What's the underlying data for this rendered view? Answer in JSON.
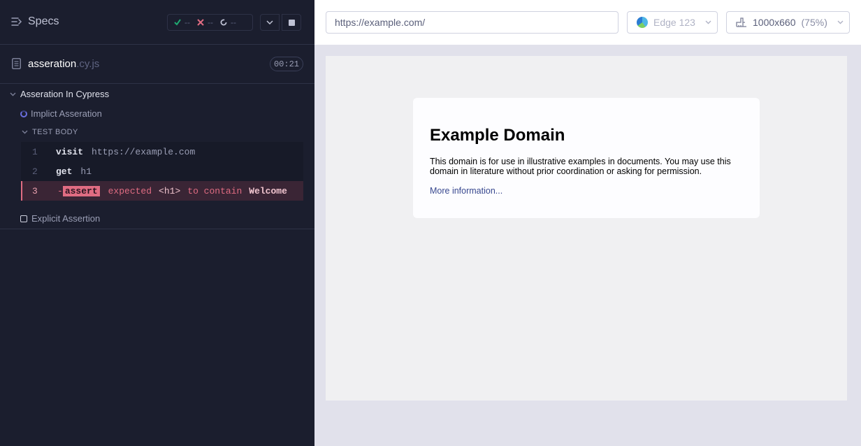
{
  "sidebar": {
    "specs_label": "Specs",
    "stats": {
      "passed": "--",
      "failed": "--",
      "pending": "--"
    },
    "file": {
      "name": "asseration",
      "ext": ".cy.js",
      "duration": "00:21"
    },
    "suite": "Asseration In Cypress",
    "tests": [
      {
        "title": "Implict Asseration",
        "state": "running"
      },
      {
        "title": "Explicit Assertion",
        "state": "pending"
      }
    ],
    "test_body_label": "TEST BODY",
    "commands": [
      {
        "num": "1",
        "name": "visit",
        "message": "https://example.com"
      },
      {
        "num": "2",
        "name": "get",
        "message": "h1"
      },
      {
        "num": "3",
        "prefix": "-",
        "name": "assert",
        "words": [
          "expected",
          "<h1>",
          "to contain",
          "Welcome"
        ]
      }
    ]
  },
  "aut": {
    "url": "https://example.com/",
    "browser": "Edge 123",
    "viewport": "1000x660",
    "zoom": "(75%)",
    "page": {
      "heading": "Example Domain",
      "paragraph": "This domain is for use in illustrative examples in documents. You may use this domain in literature without prior coordination or asking for permission.",
      "link": "More information..."
    }
  },
  "colors": {
    "sidebar_bg": "#1b1e2e",
    "fail": "#e06c82",
    "pass": "#1fa971",
    "accent": "#6b6fe0"
  }
}
